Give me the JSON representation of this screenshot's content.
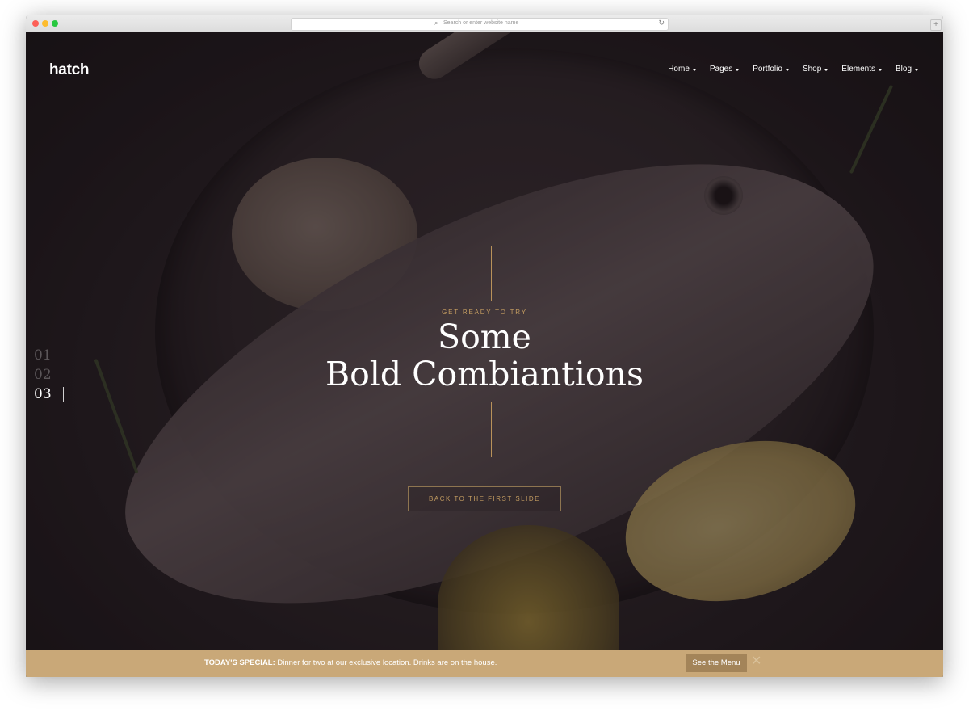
{
  "browser": {
    "url_placeholder": "Search or enter website name",
    "search_icon": "magnifier-icon",
    "reload_icon": "reload-icon",
    "new_tab_icon": "plus-icon",
    "reload_glyph": "↻",
    "new_tab_glyph": "+",
    "search_glyph": "⌕"
  },
  "header": {
    "logo": "hatch",
    "nav": [
      {
        "label": "Home"
      },
      {
        "label": "Pages"
      },
      {
        "label": "Portfolio"
      },
      {
        "label": "Shop"
      },
      {
        "label": "Elements"
      },
      {
        "label": "Blog"
      }
    ]
  },
  "slider": {
    "numbers": [
      "01",
      "02",
      "03"
    ],
    "active_index": 2
  },
  "hero": {
    "eyebrow": "GET READY TO TRY",
    "headline_line1": "Some",
    "headline_line2": "Bold Combiantions",
    "cta": "BACK TO THE FIRST SLIDE",
    "accent_color": "#c49d61"
  },
  "special": {
    "label": "TODAY'S SPECIAL:",
    "text": " Dinner for two at our exclusive location. Drinks are on the house.",
    "button": "See the Menu",
    "close_glyph": "✕",
    "bar_color": "#c9a878"
  }
}
